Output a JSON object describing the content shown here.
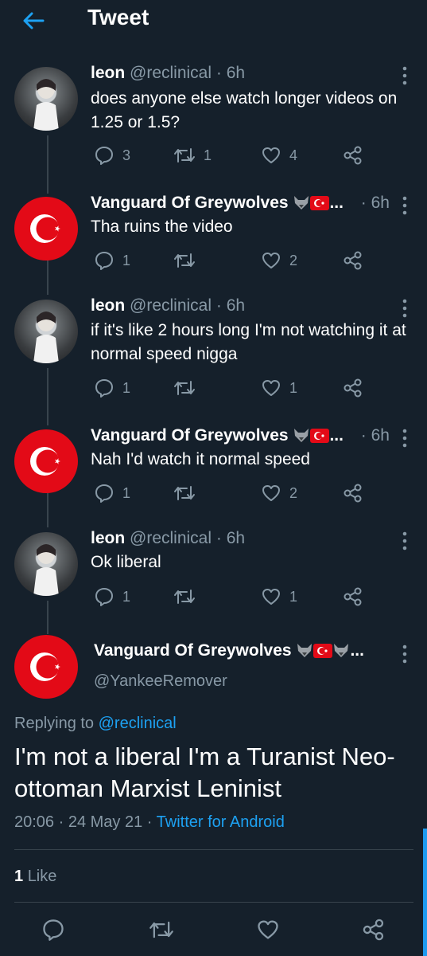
{
  "header": {
    "title": "Tweet"
  },
  "replies": [
    {
      "name": "leon",
      "handle": "@reclinical · 6h",
      "text": "does anyone else watch longer videos on 1.25 or 1.5?",
      "replies": "3",
      "retweets": "1",
      "likes": "4",
      "avatar": "leon"
    },
    {
      "name": "Vanguard Of Greywolves",
      "suffix": "...",
      "handle": "· 6h",
      "text": "Tha ruins the video",
      "replies": "1",
      "retweets": "",
      "likes": "2",
      "avatar": "turk"
    },
    {
      "name": "leon",
      "handle": "@reclinical · 6h",
      "text": "if it's like 2 hours long I'm not watching it at normal speed nigga",
      "replies": "1",
      "retweets": "",
      "likes": "1",
      "avatar": "leon"
    },
    {
      "name": "Vanguard Of Greywolves",
      "suffix": "...",
      "handle": "· 6h",
      "text": "Nah I'd watch it normal speed",
      "replies": "1",
      "retweets": "",
      "likes": "2",
      "avatar": "turk"
    },
    {
      "name": "leon",
      "handle": "@reclinical · 6h",
      "text": "Ok liberal",
      "replies": "1",
      "retweets": "",
      "likes": "1",
      "avatar": "leon"
    }
  ],
  "main_tweet": {
    "name": "Vanguard Of Greywolves",
    "suffix": "...",
    "handle": "@YankeeRemover",
    "replying_prefix": "Replying to",
    "replying_to": "@reclinical",
    "text": "I'm not a liberal I'm a Turanist Neo-ottoman Marxist Leninist",
    "time": "20:06 · 24 May 21 ·",
    "source": "Twitter for Android",
    "like_count": "1",
    "like_label": "Like"
  },
  "icons": {
    "back": "arrow-left-icon",
    "more": "vertical-dots-icon",
    "reply": "speech-bubble-icon",
    "retweet": "retweet-icon",
    "like": "heart-icon",
    "share": "share-icon"
  },
  "colors": {
    "background": "#15202b",
    "accent": "#1da1f2",
    "muted": "#8899a6",
    "divider": "#38444d"
  }
}
